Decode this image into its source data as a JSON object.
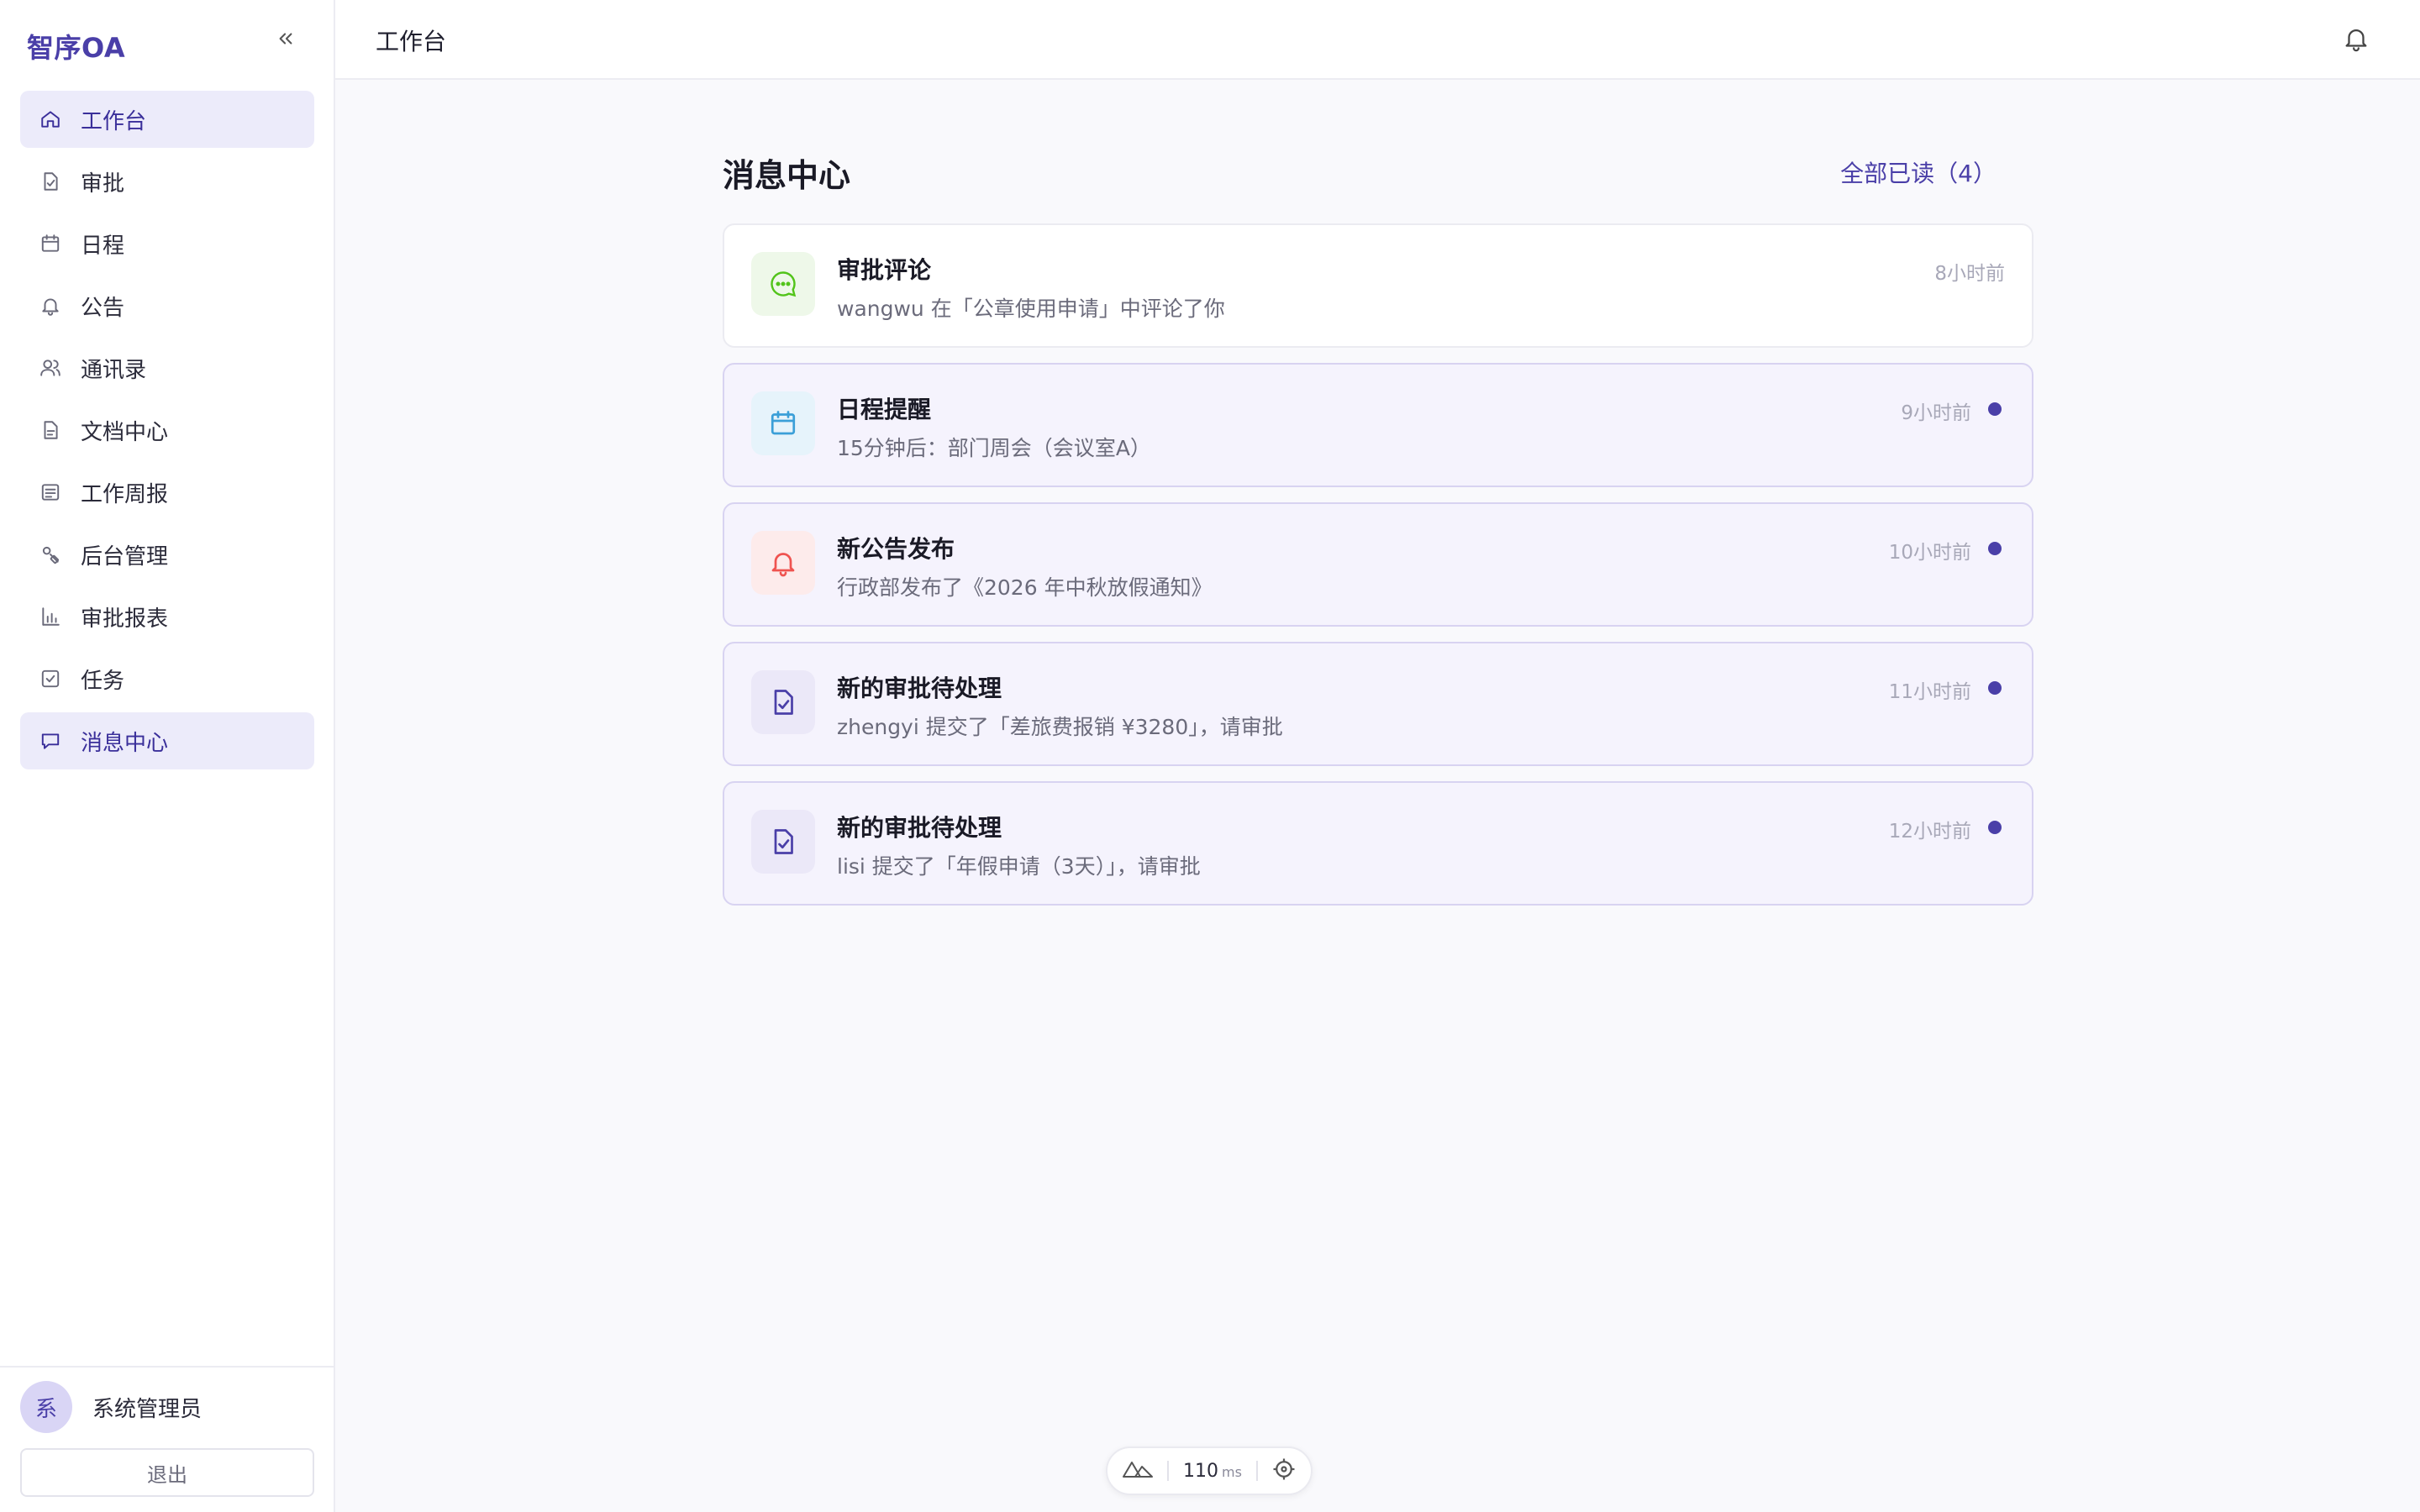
{
  "app": {
    "brand": "智序OA"
  },
  "sidebar": {
    "items": [
      {
        "label": "工作台",
        "icon": "home-icon",
        "active": true
      },
      {
        "label": "审批",
        "icon": "file-check-icon",
        "active": false
      },
      {
        "label": "日程",
        "icon": "calendar-icon",
        "active": false
      },
      {
        "label": "公告",
        "icon": "bell-icon",
        "active": false
      },
      {
        "label": "通讯录",
        "icon": "users-icon",
        "active": false
      },
      {
        "label": "文档中心",
        "icon": "document-icon",
        "active": false
      },
      {
        "label": "工作周报",
        "icon": "list-icon",
        "active": false
      },
      {
        "label": "后台管理",
        "icon": "admin-icon",
        "active": false
      },
      {
        "label": "审批报表",
        "icon": "bar-chart-icon",
        "active": false
      },
      {
        "label": "任务",
        "icon": "checkbox-icon",
        "active": false
      },
      {
        "label": "消息中心",
        "icon": "message-icon",
        "active": true
      }
    ],
    "user": {
      "avatar_text": "系",
      "name": "系统管理员"
    },
    "logout_label": "退出"
  },
  "topbar": {
    "title": "工作台"
  },
  "main": {
    "title": "消息中心",
    "mark_all_label": "全部已读（4）",
    "messages": [
      {
        "title": "审批评论",
        "body": "wangwu 在「公章使用申请」中评论了你",
        "time": "8小时前",
        "unread": false,
        "icon": "chat-icon",
        "icon_color": "#52c41a",
        "icon_bg": "#eef8e9"
      },
      {
        "title": "日程提醒",
        "body": "15分钟后：部门周会（会议室A）",
        "time": "9小时前",
        "unread": true,
        "icon": "calendar-icon",
        "icon_color": "#3b9fd8",
        "icon_bg": "#e6f3fb"
      },
      {
        "title": "新公告发布",
        "body": "行政部发布了《2026 年中秋放假通知》",
        "time": "10小时前",
        "unread": true,
        "icon": "bell-icon",
        "icon_color": "#ef5350",
        "icon_bg": "#fdebeb"
      },
      {
        "title": "新的审批待处理",
        "body": "zhengyi 提交了「差旅费报销 ¥3280」，请审批",
        "time": "11小时前",
        "unread": true,
        "icon": "file-check-icon",
        "icon_color": "#4a3fa8",
        "icon_bg": "#ebe8f8"
      },
      {
        "title": "新的审批待处理",
        "body": "lisi 提交了「年假申请（3天）」，请审批",
        "time": "12小时前",
        "unread": true,
        "icon": "file-check-icon",
        "icon_color": "#4a3fa8",
        "icon_bg": "#ebe8f8"
      }
    ]
  },
  "devtools": {
    "ms_value": "110",
    "ms_unit": "ms"
  },
  "colors": {
    "accent": "#4a3fa8",
    "unread_bg": "#f5f3fd"
  }
}
